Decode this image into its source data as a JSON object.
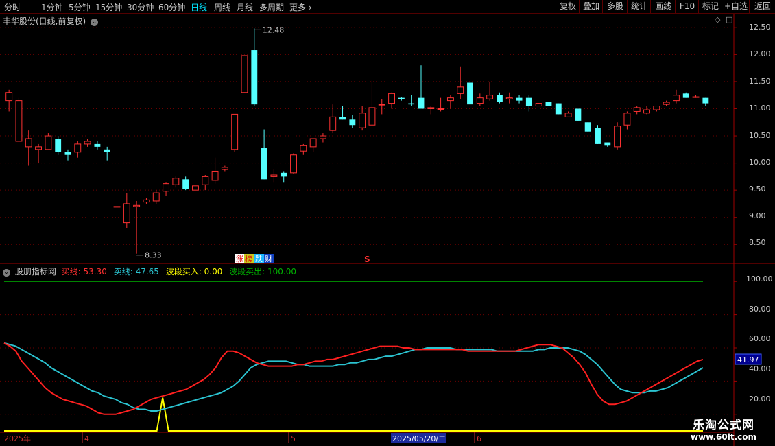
{
  "toolbar": {
    "periods": [
      "分时",
      "1分钟",
      "5分钟",
      "15分钟",
      "30分钟",
      "60分钟",
      "日线",
      "周线",
      "月线",
      "多周期",
      "更多"
    ],
    "active": "日线",
    "right_buttons": [
      "复权",
      "叠加",
      "多股",
      "统计",
      "画线",
      "F10",
      "标记",
      "+自选",
      "返回"
    ]
  },
  "main": {
    "title": "丰华股份(日线,前复权)",
    "y_ticks": [
      "12.50",
      "12.00",
      "11.50",
      "11.00",
      "10.50",
      "10.00",
      "9.50",
      "9.00",
      "8.50"
    ],
    "high_label": "12.48",
    "low_label": "8.33",
    "badge_zhang": "涨",
    "badge_bang": "榜",
    "badge_die": "跌",
    "badge_cai": "财",
    "marker_s": "S"
  },
  "indicator": {
    "name": "股朋指标网",
    "buy_label": "买线: 53.30",
    "sell_label": "卖线: 47.65",
    "wave_buy_label": "波段买入: 0.00",
    "wave_sell_label": "波段卖出: 100.00",
    "y_ticks": [
      "100.00",
      "80.00",
      "60.00",
      "40.00",
      "20.00"
    ],
    "current_value": "41.97"
  },
  "x_axis": {
    "labels": [
      "2025年",
      "4",
      "5",
      "2025/05/20/二",
      "6"
    ]
  },
  "watermark": {
    "line1": "乐淘公式网",
    "line2": "www.60lt.com"
  },
  "colors": {
    "up": "#ff3232",
    "down": "#54ffff",
    "buy_line": "#ff2020",
    "sell_line": "#2bc3d0",
    "wave_line": "#ffff00",
    "green_line": "#00b000",
    "axis_text": "#c8c8c8",
    "grid": "#6a0000"
  },
  "chart_data": [
    {
      "type": "candlestick",
      "title": "丰华股份(日线,前复权)",
      "y_range": [
        8.2,
        12.7
      ],
      "annotations": {
        "high": 12.48,
        "low": 8.33
      },
      "candles": [
        [
          11.15,
          11.35,
          10.95,
          11.3
        ],
        [
          10.4,
          11.2,
          10.4,
          11.15
        ],
        [
          10.3,
          10.6,
          9.95,
          10.45
        ],
        [
          10.25,
          10.35,
          10.0,
          10.3
        ],
        [
          10.25,
          10.55,
          10.25,
          10.5
        ],
        [
          10.45,
          10.5,
          10.15,
          10.2
        ],
        [
          10.2,
          10.25,
          10.05,
          10.15
        ],
        [
          10.2,
          10.4,
          10.1,
          10.35
        ],
        [
          10.35,
          10.45,
          10.3,
          10.4
        ],
        [
          10.35,
          10.4,
          10.25,
          10.3
        ],
        [
          10.25,
          10.3,
          10.05,
          10.2
        ],
        [
          9.2,
          9.2,
          9.2,
          9.2
        ],
        [
          8.9,
          9.45,
          8.8,
          9.25
        ],
        [
          9.2,
          9.3,
          8.33,
          9.22
        ],
        [
          9.28,
          9.35,
          9.25,
          9.32
        ],
        [
          9.3,
          9.5,
          9.25,
          9.45
        ],
        [
          9.48,
          9.65,
          9.4,
          9.62
        ],
        [
          9.6,
          9.75,
          9.55,
          9.72
        ],
        [
          9.7,
          9.75,
          9.5,
          9.52
        ],
        [
          9.5,
          9.58,
          9.5,
          9.58
        ],
        [
          9.6,
          9.78,
          9.5,
          9.75
        ],
        [
          9.68,
          10.1,
          9.62,
          9.85
        ],
        [
          9.88,
          9.95,
          9.85,
          9.92
        ],
        [
          10.25,
          10.9,
          10.2,
          10.9
        ],
        [
          11.3,
          11.98,
          11.5,
          11.98
        ],
        [
          12.08,
          12.48,
          11.05,
          11.08
        ],
        [
          10.28,
          10.62,
          9.7,
          9.7
        ],
        [
          9.75,
          9.88,
          9.65,
          9.78
        ],
        [
          9.82,
          9.85,
          9.65,
          9.75
        ],
        [
          9.82,
          10.18,
          9.8,
          10.15
        ],
        [
          10.22,
          10.35,
          10.15,
          10.32
        ],
        [
          10.3,
          10.45,
          10.2,
          10.45
        ],
        [
          10.45,
          10.55,
          10.38,
          10.5
        ],
        [
          10.6,
          11.08,
          10.55,
          10.85
        ],
        [
          10.85,
          11.05,
          10.8,
          10.8
        ],
        [
          10.8,
          10.88,
          10.65,
          10.7
        ],
        [
          10.65,
          11.05,
          10.6,
          10.92
        ],
        [
          10.7,
          11.52,
          10.68,
          11.02
        ],
        [
          11.08,
          11.18,
          10.9,
          11.08
        ],
        [
          11.1,
          11.3,
          11.0,
          11.28
        ],
        [
          11.2,
          11.22,
          11.15,
          11.18
        ],
        [
          11.1,
          11.25,
          11.05,
          11.08
        ],
        [
          11.2,
          11.8,
          11.0,
          11.0
        ],
        [
          11.0,
          11.05,
          10.9,
          11.02
        ],
        [
          11.0,
          11.2,
          10.95,
          11.0
        ],
        [
          11.15,
          11.25,
          11.0,
          11.2
        ],
        [
          11.28,
          11.78,
          11.18,
          11.4
        ],
        [
          11.48,
          11.52,
          11.05,
          11.08
        ],
        [
          11.1,
          11.28,
          11.05,
          11.2
        ],
        [
          11.18,
          11.5,
          11.15,
          11.25
        ],
        [
          11.25,
          11.3,
          11.1,
          11.12
        ],
        [
          11.18,
          11.3,
          11.1,
          11.2
        ],
        [
          11.2,
          11.25,
          11.1,
          11.15
        ],
        [
          11.2,
          11.25,
          10.95,
          11.05
        ],
        [
          11.05,
          11.1,
          11.05,
          11.1
        ],
        [
          11.12,
          11.1,
          11.05,
          11.05
        ],
        [
          11.1,
          11.1,
          10.9,
          10.9
        ],
        [
          10.85,
          10.95,
          10.85,
          10.92
        ],
        [
          11.0,
          11.0,
          10.78,
          10.78
        ],
        [
          10.75,
          10.75,
          10.58,
          10.58
        ],
        [
          10.65,
          10.7,
          10.35,
          10.35
        ],
        [
          10.38,
          10.38,
          10.3,
          10.32
        ],
        [
          10.3,
          10.75,
          10.25,
          10.68
        ],
        [
          10.7,
          10.95,
          10.62,
          10.92
        ],
        [
          10.95,
          11.05,
          10.9,
          11.02
        ],
        [
          10.92,
          11.05,
          10.9,
          10.98
        ],
        [
          10.98,
          11.05,
          10.95,
          11.05
        ],
        [
          11.08,
          11.15,
          11.05,
          11.12
        ],
        [
          11.15,
          11.35,
          11.1,
          11.25
        ],
        [
          11.28,
          11.3,
          11.2,
          11.2
        ],
        [
          11.22,
          11.25,
          11.2,
          11.22
        ],
        [
          11.2,
          11.2,
          11.05,
          11.1
        ]
      ]
    },
    {
      "type": "line",
      "title": "股朋指标网",
      "y_range": [
        10,
        110
      ],
      "series": [
        {
          "name": "买线",
          "values": [
            63,
            61,
            58,
            52,
            48,
            44,
            40,
            36,
            33,
            31,
            29,
            28,
            27,
            26,
            25,
            23,
            21,
            20,
            20,
            20,
            21,
            22,
            23,
            25,
            27,
            29,
            30,
            31,
            32,
            33,
            34,
            35,
            37,
            39,
            41,
            44,
            48,
            54,
            58,
            58,
            57,
            55,
            53,
            51,
            50,
            49,
            49,
            49,
            49,
            49,
            50,
            50,
            51,
            52,
            52,
            53,
            53,
            54,
            55,
            56,
            57,
            58,
            59,
            60,
            61,
            61,
            61,
            61,
            60,
            60,
            59,
            59,
            59,
            59,
            59,
            59,
            59,
            59,
            59,
            58,
            58,
            58,
            58,
            58,
            58,
            58,
            58,
            58,
            59,
            60,
            61,
            62,
            62,
            62,
            61,
            60,
            57,
            54,
            50,
            45,
            38,
            32,
            28,
            26,
            26,
            27,
            28,
            30,
            32,
            34,
            36,
            38,
            40,
            42,
            44,
            46,
            48,
            50,
            52,
            53
          ]
        },
        {
          "name": "卖线",
          "values": [
            63,
            62,
            61,
            59,
            57,
            55,
            53,
            51,
            48,
            46,
            44,
            42,
            40,
            38,
            36,
            34,
            33,
            31,
            30,
            29,
            27,
            26,
            24,
            23,
            23,
            22,
            22,
            23,
            24,
            25,
            26,
            27,
            28,
            29,
            30,
            31,
            32,
            33,
            35,
            37,
            40,
            44,
            48,
            50,
            51,
            52,
            52,
            52,
            52,
            51,
            50,
            50,
            49,
            49,
            49,
            49,
            49,
            50,
            50,
            51,
            51,
            52,
            53,
            53,
            54,
            55,
            55,
            56,
            57,
            58,
            59,
            59,
            60,
            60,
            60,
            60,
            60,
            59,
            59,
            59,
            59,
            59,
            59,
            59,
            58,
            58,
            58,
            58,
            58,
            58,
            58,
            59,
            59,
            60,
            60,
            60,
            60,
            59,
            58,
            56,
            53,
            50,
            46,
            42,
            38,
            35,
            34,
            33,
            33,
            33,
            34,
            34,
            35,
            36,
            38,
            40,
            42,
            44,
            46,
            48
          ]
        },
        {
          "name": "波段买入",
          "values": [
            0,
            0,
            0,
            0,
            0,
            0,
            0,
            0,
            0,
            0,
            0,
            0,
            0,
            0,
            0,
            0,
            0,
            0,
            0,
            0,
            0,
            0,
            0,
            0,
            0,
            0,
            0,
            20,
            0,
            0,
            0,
            0,
            0,
            0,
            0,
            0,
            0,
            0,
            0,
            0,
            0,
            0,
            0,
            0,
            0,
            0,
            0,
            0,
            0,
            0,
            0,
            0,
            0,
            0,
            0,
            0,
            0,
            0,
            0,
            0,
            0,
            0,
            0,
            0,
            0,
            0,
            0,
            0,
            0,
            0,
            0,
            0,
            0,
            0,
            0,
            0,
            0,
            0,
            0,
            0,
            0,
            0,
            0,
            0,
            0,
            0,
            0,
            0,
            0,
            0,
            0,
            0,
            0,
            0,
            0,
            0,
            0,
            0,
            0,
            0,
            0,
            0,
            0,
            0,
            0,
            0,
            0,
            0,
            0,
            0,
            0,
            0,
            0,
            0,
            0,
            0,
            0,
            0,
            0,
            0
          ]
        },
        {
          "name": "波段卖出",
          "values": [
            100
          ]
        }
      ]
    }
  ]
}
